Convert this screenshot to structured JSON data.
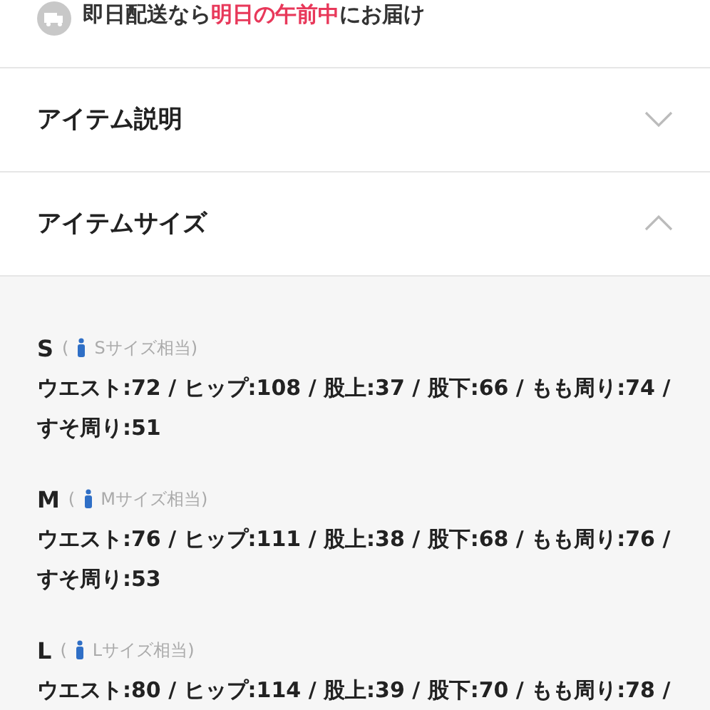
{
  "delivery": {
    "segments": [
      {
        "text": "即日配送なら",
        "highlight": false
      },
      {
        "text": "明日の午前中",
        "highlight": true
      },
      {
        "text": "にお届け",
        "highlight": false
      }
    ]
  },
  "sections": [
    {
      "title": "アイテム説明",
      "expanded": false
    },
    {
      "title": "アイテムサイズ",
      "expanded": true
    }
  ],
  "sizes": [
    {
      "label": "S",
      "open": "(",
      "equivalent": "Sサイズ相当)",
      "lines": [
        "ウエスト:72 / ヒップ:108 / 股上:37 / 股下:66 / もも周り:74 /",
        "すそ周り:51"
      ]
    },
    {
      "label": "M",
      "open": "(",
      "equivalent": "Mサイズ相当)",
      "lines": [
        "ウエスト:76 / ヒップ:111 / 股上:38 / 股下:68 / もも周り:76 /",
        "すそ周り:53"
      ]
    },
    {
      "label": "L",
      "open": "(",
      "equivalent": "Lサイズ相当)",
      "lines": [
        "ウエスト:80 / ヒップ:114 / 股上:39 / 股下:70 / もも周り:78 /"
      ]
    }
  ]
}
